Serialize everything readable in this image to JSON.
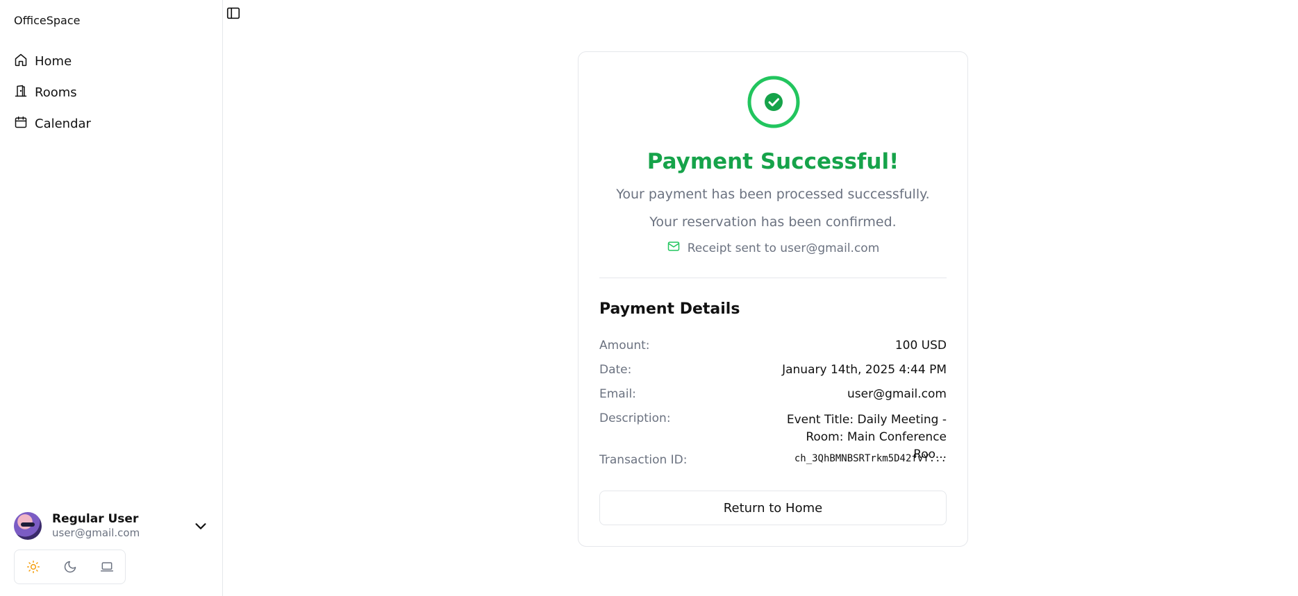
{
  "app": {
    "brand": "OfficeSpace"
  },
  "sidebar": {
    "items": [
      {
        "label": "Home",
        "icon": "home-icon"
      },
      {
        "label": "Rooms",
        "icon": "door-icon"
      },
      {
        "label": "Calendar",
        "icon": "calendar-icon"
      }
    ],
    "user": {
      "name": "Regular User",
      "email": "user@gmail.com"
    },
    "theme": {
      "options": [
        "light",
        "dark",
        "system"
      ],
      "selected": "light"
    }
  },
  "confirmation": {
    "title": "Payment Successful!",
    "line1": "Your payment has been processed successfully.",
    "line2": "Your reservation has been confirmed.",
    "receipt": "Receipt sent to user@gmail.com"
  },
  "details": {
    "title": "Payment Details",
    "rows": [
      {
        "label": "Amount:",
        "value": "100 USD"
      },
      {
        "label": "Date:",
        "value": "January 14th, 2025 4:44 PM"
      },
      {
        "label": "Email:",
        "value": "user@gmail.com"
      },
      {
        "label": "Description:",
        "value": "Event Title: Daily Meeting - Room: Main Conference Roo..."
      },
      {
        "label": "Transaction ID:",
        "value": "ch_3QhBMNBSRTrkm5D42fvY..."
      }
    ]
  },
  "actions": {
    "return_label": "Return to Home"
  },
  "colors": {
    "success": "#16a34a",
    "muted": "#6b7280",
    "border": "#e5e7eb",
    "sun": "#f59e0b"
  }
}
